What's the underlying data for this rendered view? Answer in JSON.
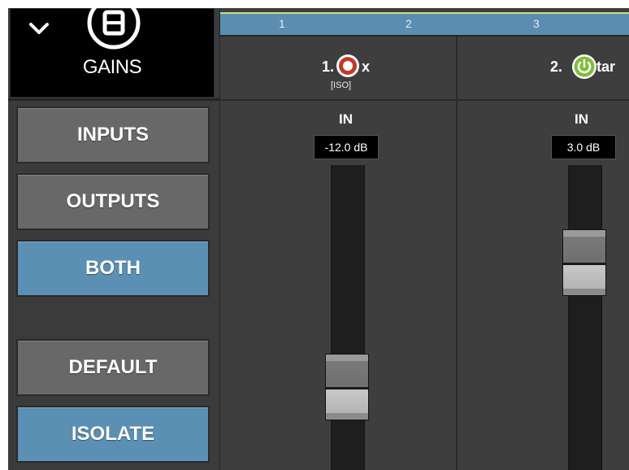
{
  "panel": {
    "title": "GAINS",
    "icons": {
      "toggle": "chevron-down-icon",
      "logo": "gains-logo-icon"
    }
  },
  "modes": [
    {
      "label": "INPUTS",
      "active": false
    },
    {
      "label": "OUTPUTS",
      "active": false
    },
    {
      "label": "BOTH",
      "active": true
    },
    {
      "label": "DEFAULT",
      "active": false
    },
    {
      "label": "ISOLATE",
      "active": true
    }
  ],
  "ruler": {
    "numbers": [
      "1",
      "2",
      "3"
    ]
  },
  "channels": [
    {
      "name_prefix": "1.",
      "name_suffix": "x",
      "tag": "[ISO]",
      "power_state": "off",
      "power_color": "#c0392b",
      "in_label": "IN",
      "gain": "-12.0 dB"
    },
    {
      "name_prefix": "2.",
      "name_suffix": "tar",
      "tag": "",
      "power_state": "on",
      "power_color": "#7fbe3d",
      "in_label": "IN",
      "gain": "3.0 dB"
    }
  ],
  "colors": {
    "active_button": "#5b8fb3",
    "inactive_button": "#686868",
    "ruler": "#5a8db0",
    "ruler_accent": "#c9e27c"
  }
}
